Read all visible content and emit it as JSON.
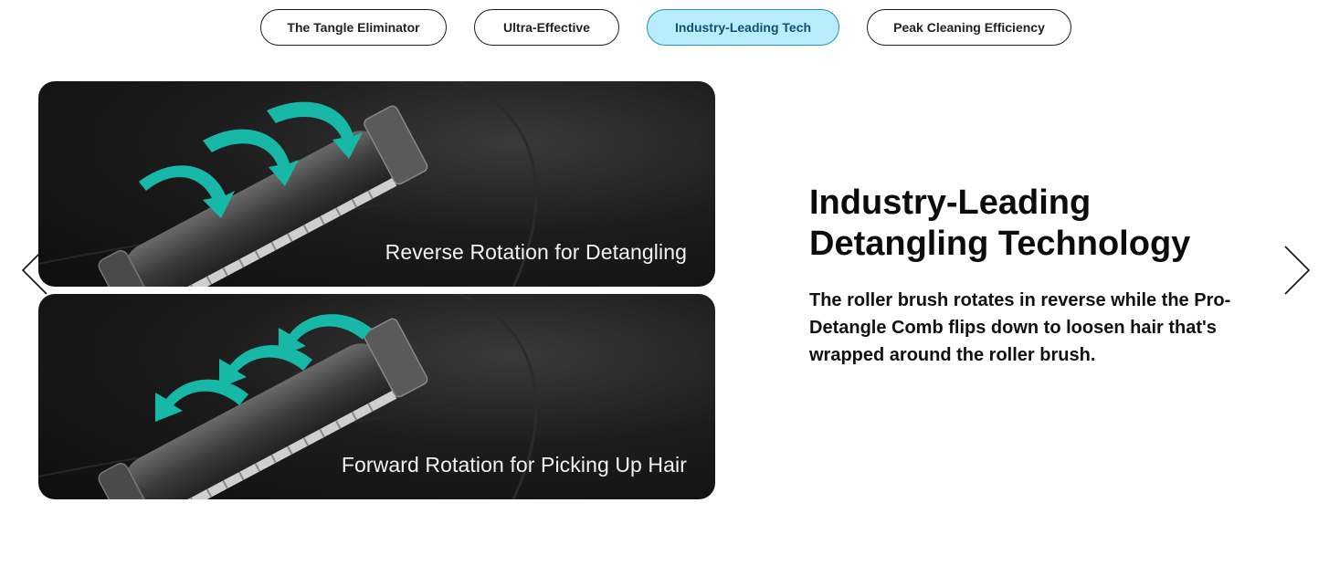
{
  "tabs": [
    {
      "label": "The Tangle Eliminator"
    },
    {
      "label": "Ultra-Effective"
    },
    {
      "label": "Industry-Leading Tech"
    },
    {
      "label": "Peak Cleaning Efficiency"
    }
  ],
  "active_tab": "Industry-Leading Tech",
  "cards": [
    {
      "caption": "Reverse Rotation for Detangling"
    },
    {
      "caption": "Forward Rotation for Picking Up Hair"
    }
  ],
  "content": {
    "heading_line1": "Industry-Leading",
    "heading_line2": "Detangling Technology",
    "description": "The roller brush rotates in reverse while the Pro-Detangle Comb  flips down to loosen hair that's wrapped around the roller brush."
  },
  "navigation": {
    "prev_icon": "chevron-left-icon",
    "next_icon": "chevron-right-icon"
  },
  "colors": {
    "active_tab_bg": "#b9ecfb",
    "arrow_teal": "#17b8a8",
    "card_bg": "#151515"
  }
}
